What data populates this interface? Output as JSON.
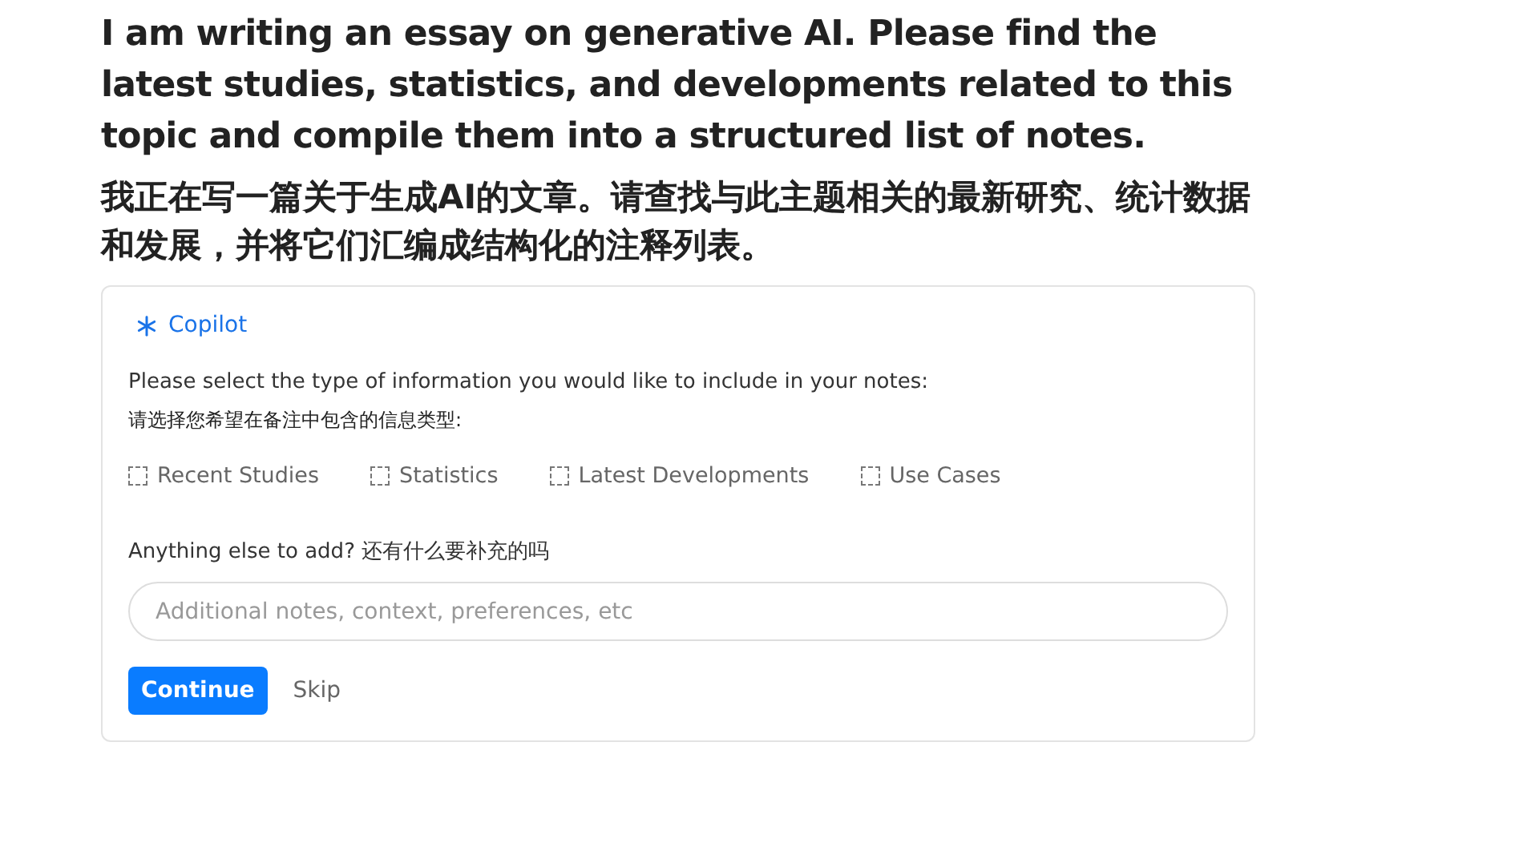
{
  "prompt": {
    "english": "I am writing an essay on generative AI. Please find the latest studies, statistics, and developments related to this topic and compile them into a structured list of notes.",
    "chinese": "我正在写一篇关于生成AI的文章。请查找与此主题相关的最新研究、统计数据和发展，并将它们汇编成结构化的注释列表。"
  },
  "card": {
    "title": "Copilot",
    "instruction": "Please select the type of information you would like to include in your notes:",
    "instruction_chinese": "请选择您希望在备注中包含的信息类型:",
    "options": [
      {
        "label": "Recent Studies",
        "checked": false
      },
      {
        "label": "Statistics",
        "checked": false
      },
      {
        "label": "Latest Developments",
        "checked": false
      },
      {
        "label": "Use Cases",
        "checked": false
      }
    ],
    "extra_label": "Anything else to add? 还有什么要补充的吗",
    "extra_field": {
      "placeholder": "Additional notes, context, preferences, etc"
    },
    "buttons": [
      {
        "label": "Continue",
        "kind": "primary"
      },
      {
        "label": "Skip",
        "kind": "plain"
      }
    ]
  }
}
